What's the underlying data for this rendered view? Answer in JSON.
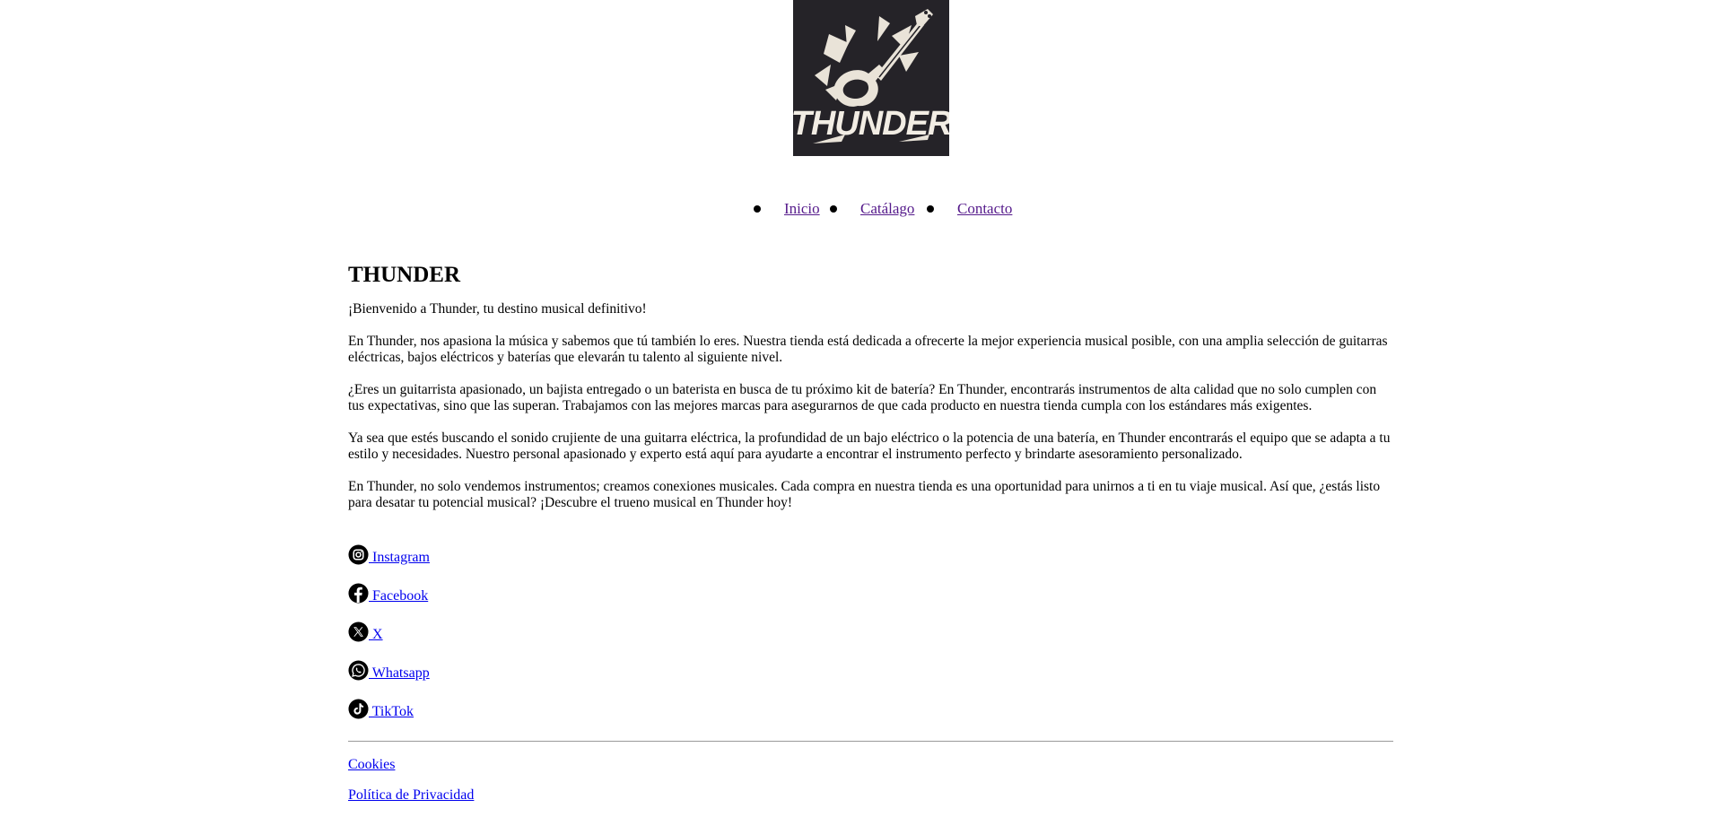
{
  "logo": {
    "text": "THUNDER",
    "bg": "#252328",
    "fg": "#f2ede4"
  },
  "nav": {
    "items": [
      {
        "label": "Inicio"
      },
      {
        "label": "Catálago"
      },
      {
        "label": "Contacto"
      }
    ],
    "link_color": "#551a8b"
  },
  "main": {
    "title": "THUNDER",
    "paragraphs": [
      "¡Bienvenido a Thunder, tu destino musical definitivo!",
      "En Thunder, nos apasiona la música y sabemos que tú también lo eres. Nuestra tienda está dedicada a ofrecerte la mejor experiencia musical posible, con una amplia selección de guitarras eléctricas, bajos eléctricos y baterías que elevarán tu talento al siguiente nivel.",
      "¿Eres un guitarrista apasionado, un bajista entregado o un baterista en busca de tu próximo kit de batería? En Thunder, encontrarás instrumentos de alta calidad que no solo cumplen con tus expectativas, sino que las superan. Trabajamos con las mejores marcas para asegurarnos de que cada producto en nuestra tienda cumpla con los estándares más exigentes.",
      "Ya sea que estés buscando el sonido crujiente de una guitarra eléctrica, la profundidad de un bajo eléctrico o la potencia de una batería, en Thunder encontrarás el equipo que se adapta a tu estilo y necesidades. Nuestro personal apasionado y experto está aquí para ayudarte a encontrar el instrumento perfecto y brindarte asesoramiento personalizado.",
      "En Thunder, no solo vendemos instrumentos; creamos conexiones musicales. Cada compra en nuestra tienda es una oportunidad para unirnos a ti en tu viaje musical. Así que, ¿estás listo para desatar tu potencial musical? ¡Descubre el trueno musical en Thunder hoy!"
    ]
  },
  "social": {
    "items": [
      {
        "label": " Instagram",
        "icon": "instagram-icon"
      },
      {
        "label": " Facebook",
        "icon": "facebook-icon"
      },
      {
        "label": " X",
        "icon": "x-icon"
      },
      {
        "label": " Whatsapp",
        "icon": "whatsapp-icon"
      },
      {
        "label": " TikTok",
        "icon": "tiktok-icon"
      }
    ],
    "link_color": "#0000ee"
  },
  "footer": {
    "links": [
      {
        "label": "Cookies"
      },
      {
        "label": "Política de Privacidad"
      }
    ]
  }
}
